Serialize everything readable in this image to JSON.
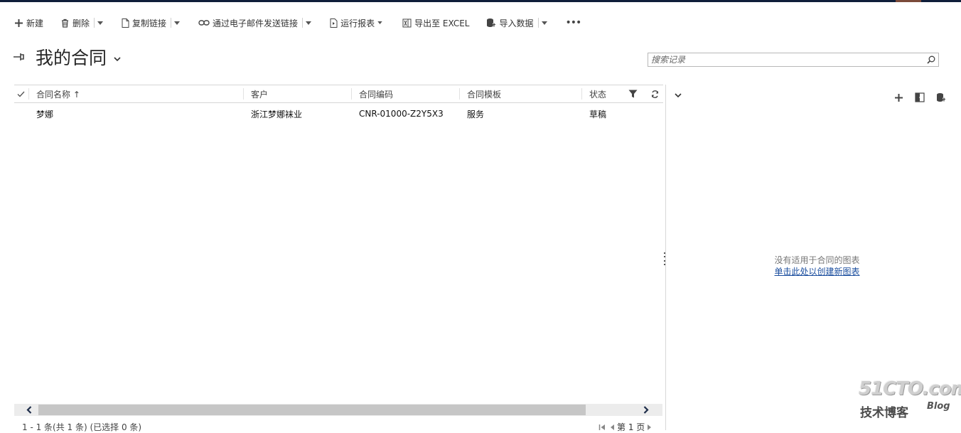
{
  "command_bar": {
    "new_label": "新建",
    "delete_label": "删除",
    "copy_link_label": "复制链接",
    "email_link_label": "通过电子邮件发送链接",
    "run_report_label": "运行报表",
    "export_excel_label": "导出至 EXCEL",
    "import_data_label": "导入数据",
    "more_label": "•••"
  },
  "view": {
    "title": "我的合同"
  },
  "search": {
    "placeholder": "搜索记录"
  },
  "grid": {
    "columns": [
      {
        "label": "合同名称 ↑"
      },
      {
        "label": "客户"
      },
      {
        "label": "合同编码"
      },
      {
        "label": "合同模板"
      },
      {
        "label": "状态"
      }
    ],
    "rows": [
      {
        "name": "梦娜",
        "customer": "浙江梦娜袜业",
        "code": "CNR-01000-Z2Y5X3",
        "template": "服务",
        "status": "草稿"
      }
    ]
  },
  "footer": {
    "record_count": "1 - 1 条(共 1 条) (已选择 0 条)",
    "page_label": "第 1 页"
  },
  "chart_pane": {
    "no_chart_text": "没有适用于合同的图表",
    "create_chart_link": "单击此处以创建新图表"
  },
  "watermark": {
    "main": "51CTO.com",
    "sub": "技术博客",
    "blog": "Blog"
  },
  "colors": {
    "top_bar": "#0f1e3a",
    "link": "#1a4d9e",
    "scroll_thumb": "#c6c6c6"
  }
}
